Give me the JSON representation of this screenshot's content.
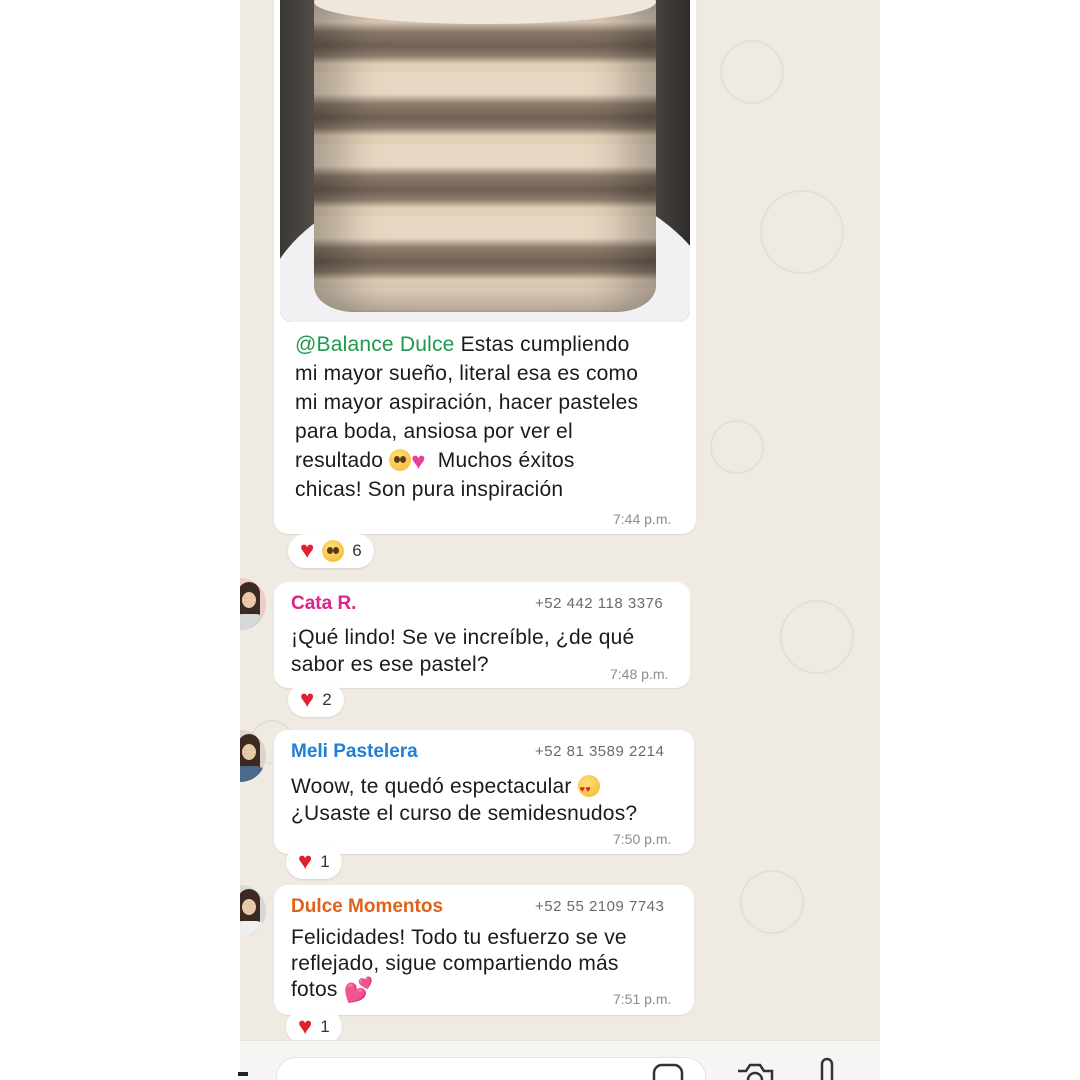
{
  "chat": {
    "messages": [
      {
        "mention": "@Balance Dulce",
        "text_lines": [
          " Estas cumpliendo",
          "mi mayor sueño, literal esa es como",
          "mi mayor aspiración, hacer pasteles",
          "para boda, ansiosa por ver el",
          "resultado ",
          "Muchos éxitos",
          "chicas! Son pura inspiración"
        ],
        "time": "7:44 p.m.",
        "reaction_count": "6"
      },
      {
        "sender": "Cata R.",
        "sender_color": "#e0218a",
        "phone": "+52 442 118 3376",
        "text_lines": [
          "¡Qué lindo! Se ve increíble, ¿de qué",
          "sabor es ese pastel?"
        ],
        "time": "7:48 p.m.",
        "reaction_count": "2"
      },
      {
        "sender": "Meli Pastelera",
        "sender_color": "#1f7fd6",
        "phone": "+52 81 3589 2214",
        "text_lines": [
          "Woow, te quedó espectacular ",
          "¿Usaste el curso de semidesnudos?"
        ],
        "time": "7:50 p.m.",
        "reaction_count": "1"
      },
      {
        "sender": "Dulce Momentos",
        "sender_color": "#e0621a",
        "phone": "+52 55 2109 7743",
        "text_lines": [
          "Felicidades! Todo tu esfuerzo se ve",
          "reflejado, sigue compartiendo más",
          "fotos "
        ],
        "time": "7:51 p.m.",
        "reaction_count": "1"
      }
    ]
  },
  "icons": {
    "reaction_heart": "heart-icon",
    "reaction_pleading": "pleading-face-icon",
    "sticker": "sticker-icon",
    "camera": "camera-icon",
    "microphone": "microphone-icon"
  },
  "colors": {
    "mention": "#1b9a4a",
    "chat_background": "#efeae2",
    "bubble": "#ffffff"
  }
}
